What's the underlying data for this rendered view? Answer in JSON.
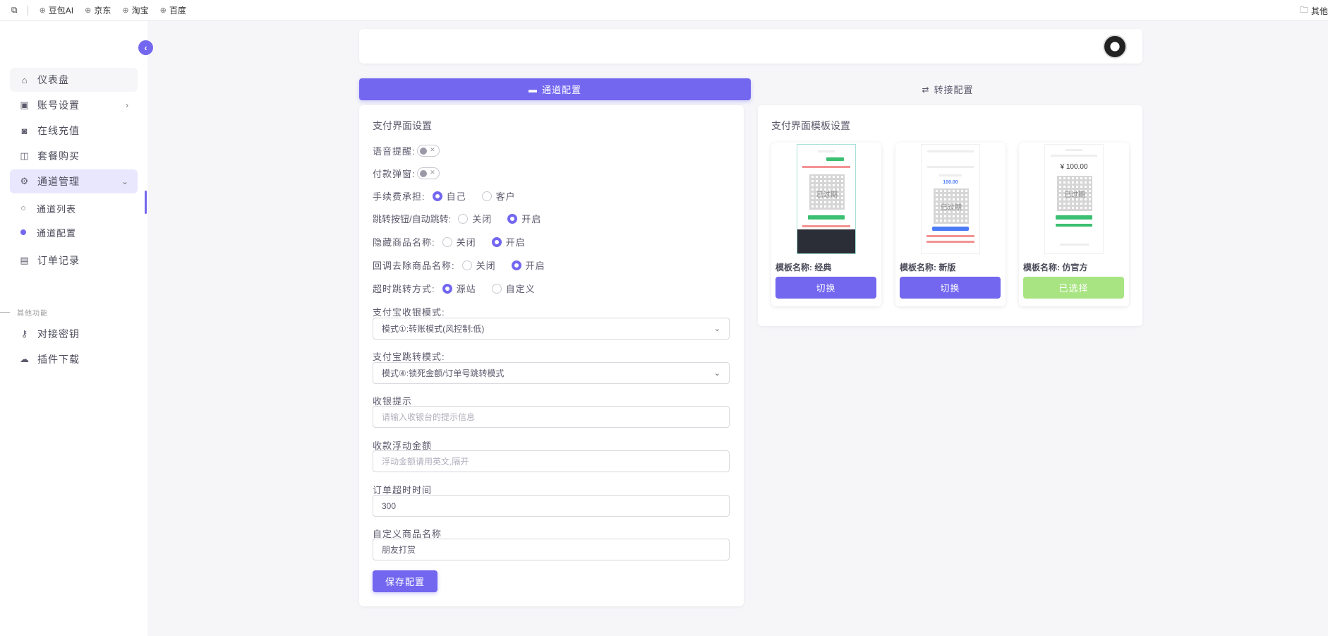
{
  "bookmarks": {
    "items": [
      "豆包AI",
      "京东",
      "淘宝",
      "百度"
    ],
    "right": "其他"
  },
  "sidebar": {
    "items": {
      "dashboard": "仪表盘",
      "account": "账号设置",
      "recharge": "在线充值",
      "package": "套餐购买",
      "channel": "通道管理",
      "channel_list": "通道列表",
      "channel_config": "通道配置",
      "orders": "订单记录",
      "section_other": "其他功能",
      "keys": "对接密钥",
      "plugin": "插件下载"
    }
  },
  "tabs": {
    "channel_config": "通道配置",
    "transfer_config": "转接配置"
  },
  "config": {
    "title": "支付界面设置",
    "voice_label": "语音提醒:",
    "popup_label": "付款弹窗:",
    "fee_label": "手续费承担:",
    "fee_opt1": "自己",
    "fee_opt2": "客户",
    "jump_label": "跳转按钮/自动跳转:",
    "hide_label": "隐藏商品名称:",
    "callback_label": "回调去除商品名称:",
    "off": "关闭",
    "on": "开启",
    "timeout_jump_label": "超时跳转方式:",
    "timeout_opt1": "源站",
    "timeout_opt2": "自定义",
    "alipay_cashier_label": "支付宝收银模式:",
    "alipay_cashier_value": "模式①:转账模式(风控制:低)",
    "alipay_jump_label": "支付宝跳转模式:",
    "alipay_jump_value": "模式④:锁死金额/订单号跳转模式",
    "cashier_tip_label": "收银提示",
    "cashier_tip_placeholder": "请输入收银台的提示信息",
    "float_label": "收款浮动金额",
    "float_placeholder": "浮动金额请用英文,隔开",
    "order_timeout_label": "订单超时时间",
    "order_timeout_value": "300",
    "custom_name_label": "自定义商品名称",
    "custom_name_value": "朋友打赏",
    "save_button": "保存配置"
  },
  "templates": {
    "title": "支付界面模板设置",
    "preview_qr_text": "已过期",
    "preview_price": "¥ 100.00",
    "items": [
      {
        "name": "模板名称: 经典",
        "button": "切换"
      },
      {
        "name": "模板名称: 新版",
        "button": "切换"
      },
      {
        "name": "模板名称: 仿官方",
        "button": "已选择"
      }
    ]
  },
  "colors": {
    "accent": "#7367f0",
    "selected": "#a8e482"
  }
}
